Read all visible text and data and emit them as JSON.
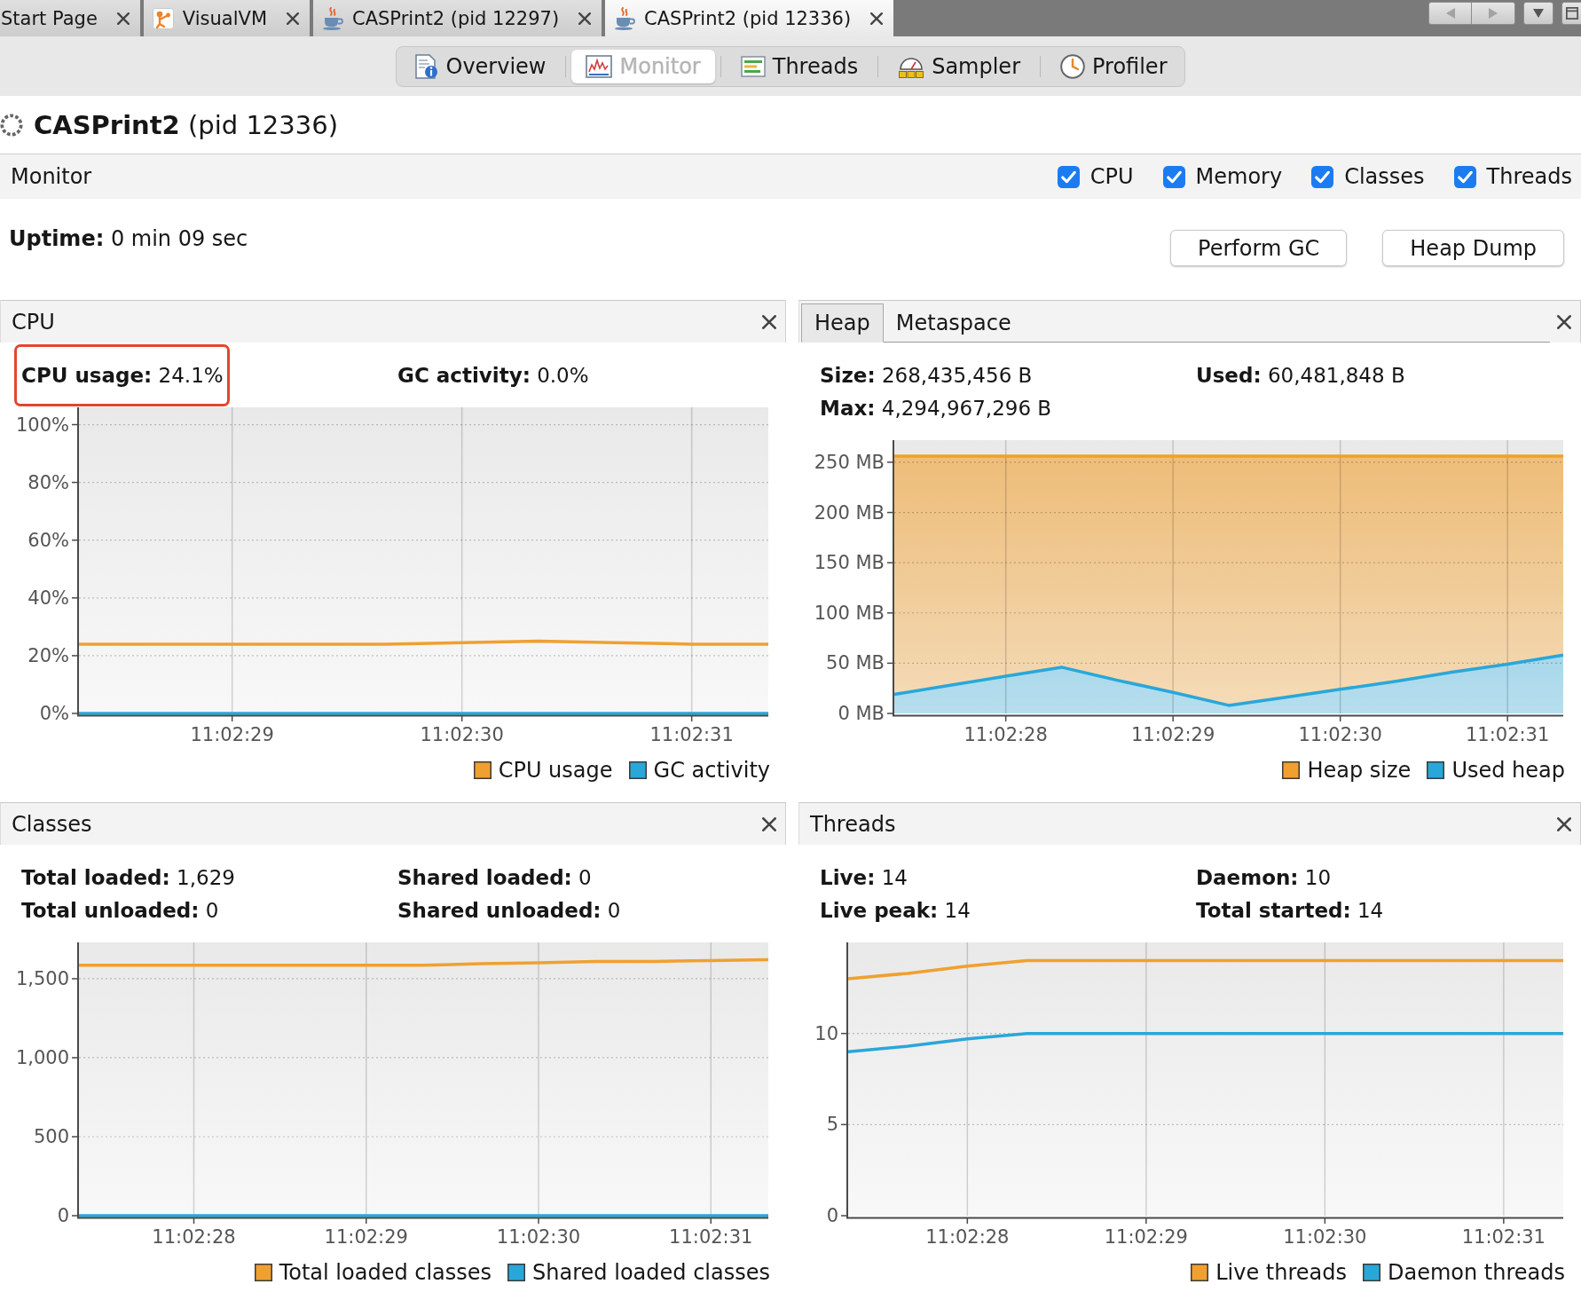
{
  "window_tabs": [
    {
      "label": "Start Page",
      "kind": "page",
      "selected": false
    },
    {
      "label": "VisualVM",
      "kind": "app",
      "selected": false
    },
    {
      "label": "CASPrint2 (pid 12297)",
      "kind": "process",
      "selected": false
    },
    {
      "label": "CASPrint2 (pid 12336)",
      "kind": "process",
      "selected": true
    }
  ],
  "view_tabs": [
    {
      "label": "Overview",
      "kind": "overview",
      "selected": false
    },
    {
      "label": "Monitor",
      "kind": "monitor",
      "selected": true
    },
    {
      "label": "Threads",
      "kind": "threads",
      "selected": false
    },
    {
      "label": "Sampler",
      "kind": "sampler",
      "selected": false
    },
    {
      "label": "Profiler",
      "kind": "profiler",
      "selected": false
    }
  ],
  "title": "**CASPrint2** (pid 12336)",
  "monitor_bar": {
    "label": "Monitor",
    "options": [
      {
        "label": "CPU",
        "checked": true
      },
      {
        "label": "Memory",
        "checked": true
      },
      {
        "label": "Classes",
        "checked": true
      },
      {
        "label": "Threads",
        "checked": true
      }
    ]
  },
  "uptime": "**Uptime:** 0 min 09 sec",
  "buttons": [
    "Perform GC",
    "Heap Dump"
  ],
  "panels": [
    {
      "kind": "single",
      "title": "CPU",
      "stats": [
        {
          "text": "**CPU usage:** 24.1%",
          "highlighted": true
        },
        {
          "text": "**GC activity:** 0.0%",
          "highlighted": false
        }
      ],
      "chart_data": {
        "type": "line",
        "grid": true,
        "categories": [
          null,
          null,
          "11:02:29",
          null,
          null,
          "11:02:30",
          null,
          null,
          "11:02:31",
          null
        ],
        "series": [
          {
            "name": "CPU usage",
            "color": "#f0a030",
            "values": [
              24,
              24,
              24,
              24,
              24,
              24.5,
              25,
              24.5,
              24,
              24
            ]
          },
          {
            "name": "GC activity",
            "color": "#29a7d9",
            "values": [
              0,
              0,
              0,
              0,
              0,
              0,
              0,
              0,
              0,
              0
            ]
          }
        ],
        "ylim": [
          0,
          106
        ],
        "yticks": [
          {
            "value": 0,
            "label": "0%"
          },
          {
            "value": 20,
            "label": "20%"
          },
          {
            "value": 40,
            "label": "40%"
          },
          {
            "value": 60,
            "label": "60%"
          },
          {
            "value": 80,
            "label": "80%"
          },
          {
            "value": 100,
            "label": "100%"
          }
        ]
      }
    },
    {
      "kind": "tabbed",
      "tabs": [
        {
          "label": "Heap",
          "selected": true
        },
        {
          "label": "Metaspace",
          "selected": false
        }
      ],
      "stats": [
        {
          "text": "**Size:** 268,435,456 B",
          "highlighted": false
        },
        {
          "text": "**Used:** 60,481,848 B",
          "highlighted": false
        },
        {
          "text": "**Max:** 4,294,967,296 B",
          "highlighted": false
        }
      ],
      "chart_data": {
        "type": "area",
        "grid": true,
        "categories": [
          null,
          null,
          "11:02:28",
          null,
          null,
          "11:02:29",
          null,
          null,
          "11:02:30",
          null,
          null,
          "11:02:31",
          null
        ],
        "series": [
          {
            "name": "Heap size",
            "color": "#f0a030",
            "values": [
              256,
              256,
              256,
              256,
              256,
              256,
              256,
              256,
              256,
              256,
              256,
              256,
              256
            ]
          },
          {
            "name": "Used heap",
            "color": "#29a7d9",
            "values": [
              19,
              28,
              37,
              46,
              33,
              21,
              8,
              16,
              24,
              32,
              41,
              49,
              58
            ]
          }
        ],
        "ylim": [
          0,
          272
        ],
        "yticks": [
          {
            "value": 0,
            "label": "0 MB"
          },
          {
            "value": 50,
            "label": "50 MB"
          },
          {
            "value": 100,
            "label": "100 MB"
          },
          {
            "value": 150,
            "label": "150 MB"
          },
          {
            "value": 200,
            "label": "200 MB"
          },
          {
            "value": 250,
            "label": "250 MB"
          }
        ]
      }
    },
    {
      "kind": "single",
      "title": "Classes",
      "stats": [
        {
          "text": "**Total loaded:** 1,629",
          "highlighted": false
        },
        {
          "text": "**Shared loaded:** 0",
          "highlighted": false
        },
        {
          "text": "**Total unloaded:** 0",
          "highlighted": false
        },
        {
          "text": "**Shared unloaded:** 0",
          "highlighted": false
        }
      ],
      "chart_data": {
        "type": "line",
        "grid": true,
        "categories": [
          null,
          null,
          "11:02:28",
          null,
          null,
          "11:02:29",
          null,
          null,
          "11:02:30",
          null,
          null,
          "11:02:31",
          null
        ],
        "series": [
          {
            "name": "Total loaded classes",
            "color": "#f0a030",
            "values": [
              1585,
              1585,
              1585,
              1585,
              1585,
              1585,
              1585,
              1595,
              1600,
              1610,
              1610,
              1615,
              1620
            ]
          },
          {
            "name": "Shared loaded classes",
            "color": "#29a7d9",
            "values": [
              0,
              0,
              0,
              0,
              0,
              0,
              0,
              0,
              0,
              0,
              0,
              0,
              0
            ]
          }
        ],
        "ylim": [
          0,
          1730
        ],
        "yticks": [
          0,
          500,
          {
            "value": 1000,
            "label": "1,000"
          },
          {
            "value": 1500,
            "label": "1,500"
          }
        ]
      }
    },
    {
      "kind": "single",
      "title": "Threads",
      "stats": [
        {
          "text": "**Live:** 14",
          "highlighted": false
        },
        {
          "text": "**Daemon:** 10",
          "highlighted": false
        },
        {
          "text": "**Live peak:** 14",
          "highlighted": false
        },
        {
          "text": "**Total started:** 14",
          "highlighted": false
        }
      ],
      "chart_data": {
        "type": "line",
        "grid": true,
        "categories": [
          null,
          null,
          "11:02:28",
          null,
          null,
          "11:02:29",
          null,
          null,
          "11:02:30",
          null,
          null,
          "11:02:31",
          null
        ],
        "series": [
          {
            "name": "Live threads",
            "color": "#f0a030",
            "values": [
              13,
              13.3,
              13.7,
              14,
              14,
              14,
              14,
              14,
              14,
              14,
              14,
              14,
              14
            ]
          },
          {
            "name": "Daemon threads",
            "color": "#29a7d9",
            "values": [
              9,
              9.3,
              9.7,
              10,
              10,
              10,
              10,
              10,
              10,
              10,
              10,
              10,
              10
            ]
          }
        ],
        "ylim": [
          0,
          15
        ],
        "yticks": [
          0,
          5,
          10
        ]
      }
    }
  ]
}
